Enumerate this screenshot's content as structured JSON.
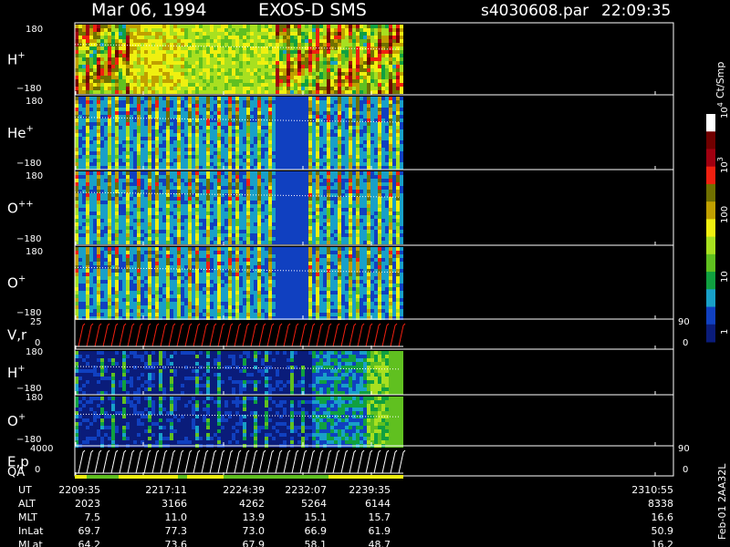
{
  "header": {
    "date": "Mar 06, 1994",
    "instrument": "EXOS-D SMS",
    "file": "s4030608.par",
    "time": "22:09:35"
  },
  "colors": {
    "background": "#000000",
    "foreground": "#ffffff",
    "scale": [
      "#0a1c7a",
      "#1040c0",
      "#18a0c8",
      "#10a040",
      "#60c020",
      "#a8e020",
      "#f0f010",
      "#c0a000",
      "#707000",
      "#f02010",
      "#a00010",
      "#700000",
      "#ffffff"
    ]
  },
  "colorbar": {
    "label": "Ct/Smp",
    "ticks": [
      {
        "base": "1",
        "exp": ""
      },
      {
        "base": "10",
        "exp": ""
      },
      {
        "base": "100",
        "exp": ""
      },
      {
        "base": "10",
        "exp": "3"
      },
      {
        "base": "10",
        "exp": "4"
      }
    ]
  },
  "side_label": "Feb-01 2AA32L",
  "footer": {
    "row_labels": [
      "UT",
      "ALT",
      "MLT",
      "InLat",
      "MLat"
    ],
    "columns": [
      {
        "values": [
          "2209:35",
          "2023",
          "7.5",
          "69.7",
          "64.2"
        ]
      },
      {
        "values": [
          "2217:11",
          "3166",
          "11.0",
          "77.3",
          "73.6"
        ]
      },
      {
        "values": [
          "2224:39",
          "4262",
          "13.9",
          "73.0",
          "67.9"
        ]
      },
      {
        "values": [
          "2232:07",
          "5264",
          "15.1",
          "66.9",
          "58.1"
        ]
      },
      {
        "values": [
          "2239:35",
          "6144",
          "15.7",
          "61.9",
          "48.7"
        ]
      },
      {
        "values": [
          "2310:55",
          "8338",
          "16.6",
          "50.9",
          "16.2"
        ]
      }
    ]
  },
  "chart_data": {
    "type": "heatmap",
    "time_ticks": [
      "2209:35",
      "2217:11",
      "2224:39",
      "2232:07",
      "2239:35",
      "2310:55"
    ],
    "panels": [
      {
        "name": "H+",
        "label": "H",
        "sup": "+",
        "ylim": [
          "180",
          "−180"
        ],
        "data_until": "~2243",
        "kind": "spin_pitch_angle"
      },
      {
        "name": "He+",
        "label": "He",
        "sup": "+",
        "ylim": [
          "180",
          "−180"
        ],
        "data_until": "~2243",
        "kind": "spin_pitch_angle"
      },
      {
        "name": "O++",
        "label": "O",
        "sup": "++",
        "ylim": [
          "180",
          "−180"
        ],
        "data_until": "~2243",
        "kind": "spin_pitch_angle"
      },
      {
        "name": "O+",
        "label": "O",
        "sup": "+",
        "ylim": [
          "180",
          "−180"
        ],
        "data_until": "~2243",
        "kind": "spin_pitch_angle"
      },
      {
        "name": "V,r",
        "label": "V,r",
        "sup": "",
        "ylim": [
          "25",
          "0"
        ],
        "right_ticks": [
          "90",
          "0"
        ],
        "kind": "line_trace"
      },
      {
        "name": "H+ (2)",
        "label": "H",
        "sup": "+",
        "ylim": [
          "180",
          "−180"
        ],
        "kind": "sweep"
      },
      {
        "name": "O+ (2)",
        "label": "O",
        "sup": "+",
        "ylim": [
          "180",
          "−180"
        ],
        "kind": "sweep"
      },
      {
        "name": "E,p",
        "label": "E,p",
        "sup": "",
        "ylim": [
          "4000",
          "0"
        ],
        "right_ticks": [
          "90",
          "0"
        ],
        "kind": "line_trace"
      }
    ],
    "qa_label": "QA",
    "colorbar_scale": "log",
    "colorbar_range": [
      1,
      10000
    ]
  }
}
